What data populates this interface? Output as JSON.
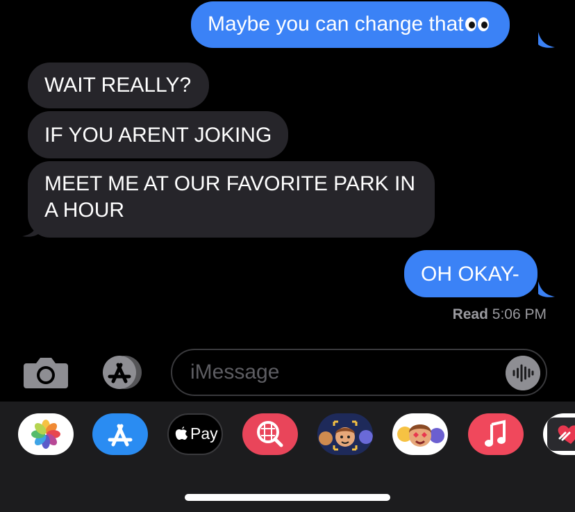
{
  "messages": [
    {
      "id": "b1",
      "direction": "sent",
      "text": "Maybe you can change that",
      "emoji": "eyes-emoji"
    },
    {
      "id": "b2",
      "direction": "received",
      "text": "WAIT REALLY?"
    },
    {
      "id": "b3",
      "direction": "received",
      "text": "IF YOU ARENT JOKING"
    },
    {
      "id": "b4",
      "direction": "received",
      "text": "MEET ME AT OUR FAVORITE PARK IN A HOUR"
    },
    {
      "id": "b5",
      "direction": "sent",
      "text": "OH OKAY-"
    }
  ],
  "receipt": {
    "label": "Read",
    "time": "5:06 PM"
  },
  "composer": {
    "placeholder": "iMessage"
  },
  "app_tray": {
    "items": [
      {
        "name": "photos-app-icon"
      },
      {
        "name": "app-store-icon"
      },
      {
        "name": "apple-pay-icon",
        "label": "Pay"
      },
      {
        "name": "images-search-icon"
      },
      {
        "name": "memoji-icon"
      },
      {
        "name": "memoji-stickers-icon"
      },
      {
        "name": "music-icon"
      },
      {
        "name": "digital-touch-icon"
      }
    ]
  },
  "colors": {
    "sent_bubble": "#3b82f6",
    "received_bubble": "#26252a",
    "background": "#000000",
    "tray": "#1c1c1e"
  }
}
